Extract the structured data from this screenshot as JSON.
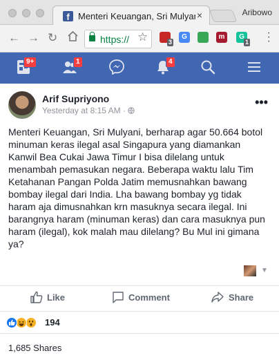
{
  "browser": {
    "tab_title": "Menteri Keuangan, Sri Mulyani, be",
    "tab_close": "×",
    "favicon": "f",
    "profile_name": "Aribowo",
    "url": "https://",
    "extensions": [
      {
        "name": "red-shield",
        "color": "#c62828",
        "letter": "",
        "badge": "3"
      },
      {
        "name": "translate",
        "color": "#4a8af4",
        "letter": "G",
        "badge": ""
      },
      {
        "name": "download",
        "color": "#3aa757",
        "letter": "",
        "badge": ""
      },
      {
        "name": "mendeley",
        "color": "#a6192e",
        "letter": "m",
        "badge": ""
      },
      {
        "name": "grammarly",
        "color": "#15c39a",
        "letter": "G",
        "badge": "1"
      }
    ]
  },
  "fb_nav": {
    "items": [
      {
        "name": "news-feed",
        "badge": "9+"
      },
      {
        "name": "friend-requests",
        "badge": "1"
      },
      {
        "name": "messenger",
        "badge": ""
      },
      {
        "name": "notifications",
        "badge": "4"
      },
      {
        "name": "search",
        "badge": ""
      },
      {
        "name": "menu",
        "badge": ""
      }
    ]
  },
  "post": {
    "author": "Arif Supriyono",
    "meta": "Yesterday at 8:15 AM · ",
    "privacy_icon": "globe-icon",
    "more": "•••",
    "text": "Menteri Keuangan, Sri Mulyani, berharap agar 50.664 botol minuman keras ilegal asal Singapura yang diamankan Kanwil Bea Cukai Jawa Timur I bisa dilelang untuk menambah pemasukan negara. Beberapa waktu lalu Tim Ketahanan Pangan Polda Jatim memusnahkan bawang bombay ilegal dari India. Lha bawang bombay yg tidak haram aja dimusnahkan krn masuknya secara ilegal. Ini barangnya haram (minuman keras) dan cara masuknya pun haram (ilegal), kok malah mau dilelang? Bu Mul ini gimana ya?",
    "actions": {
      "like": "Like",
      "comment": "Comment",
      "share": "Share"
    },
    "reaction_count": "194",
    "reactions": [
      "like",
      "haha",
      "wow"
    ],
    "shares": "1,685 Shares"
  },
  "colors": {
    "fb_blue": "#4267b2",
    "badge_red": "#fa3e3e",
    "text": "#1d2129",
    "muted": "#90949c",
    "secure_green": "#0b8043"
  }
}
